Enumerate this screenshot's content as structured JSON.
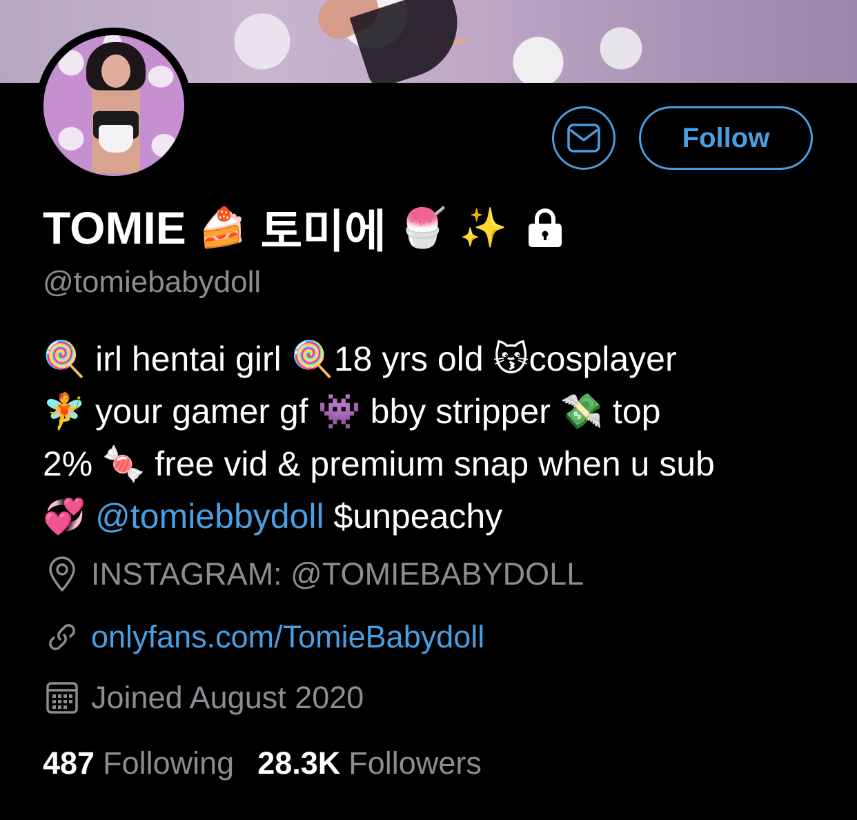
{
  "profile": {
    "display_name": "TOMIE",
    "name_emoji_1": "🍰",
    "name_korean": "토미에",
    "name_emoji_2": "🍧",
    "name_emoji_3": "✨",
    "handle": "@tomiebabydoll",
    "protected_icon": "lock-icon"
  },
  "actions": {
    "message_icon": "envelope-icon",
    "follow_label": "Follow"
  },
  "bio": {
    "line1": "🍭 irl hentai girl 🍭18 yrs old 😽cosplayer",
    "line2": "🧚 your gamer gf 👾 bby stripper 💸 top",
    "line3": "2% 🍬 free vid & premium snap when u sub",
    "line4_emoji": "💞 ",
    "line4_mention": "@tomiebbydoll",
    "line4_rest": " $unpeachy"
  },
  "meta": {
    "location_icon": "location-pin-icon",
    "location": "INSTAGRAM: @TOMIEBABYDOLL",
    "link_icon": "link-icon",
    "link": "onlyfans.com/TomieBabydoll",
    "joined_icon": "calendar-icon",
    "joined": "Joined August 2020"
  },
  "stats": {
    "following_count": "487",
    "following_label": "Following",
    "followers_count": "28.3K",
    "followers_label": "Followers"
  },
  "colors": {
    "background": "#000000",
    "accent": "#4a9fe3",
    "secondary_text": "#8a8d91",
    "primary_text": "#ffffff"
  }
}
